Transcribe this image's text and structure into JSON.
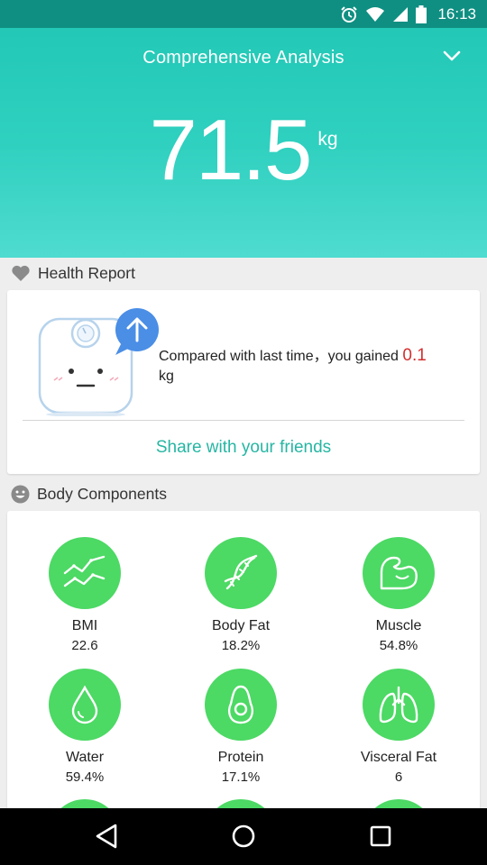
{
  "status_bar": {
    "time": "16:13"
  },
  "hero": {
    "title": "Comprehensive Analysis",
    "weight": "71.5",
    "unit": "kg"
  },
  "health_report": {
    "heading": "Health Report",
    "message": "Compared with last time，you gained",
    "gain": "0.1",
    "gain_unit": "kg",
    "share": "Share with your friends"
  },
  "body_components": {
    "heading": "Body Components",
    "items": [
      {
        "label": "BMI",
        "value": "22.6",
        "icon": "trend-chart-icon"
      },
      {
        "label": "Body Fat",
        "value": "18.2%",
        "icon": "dna-icon"
      },
      {
        "label": "Muscle",
        "value": "54.8%",
        "icon": "muscle-arm-icon"
      },
      {
        "label": "Water",
        "value": "59.4%",
        "icon": "water-drop-icon"
      },
      {
        "label": "Protein",
        "value": "17.1%",
        "icon": "avocado-icon"
      },
      {
        "label": "Visceral Fat",
        "value": "6",
        "icon": "lungs-icon"
      }
    ]
  },
  "colors": {
    "accent": "#26b6a3",
    "hero_top": "#23c8b6",
    "component_green": "#4cd964",
    "gain_red": "#d32f2f"
  }
}
